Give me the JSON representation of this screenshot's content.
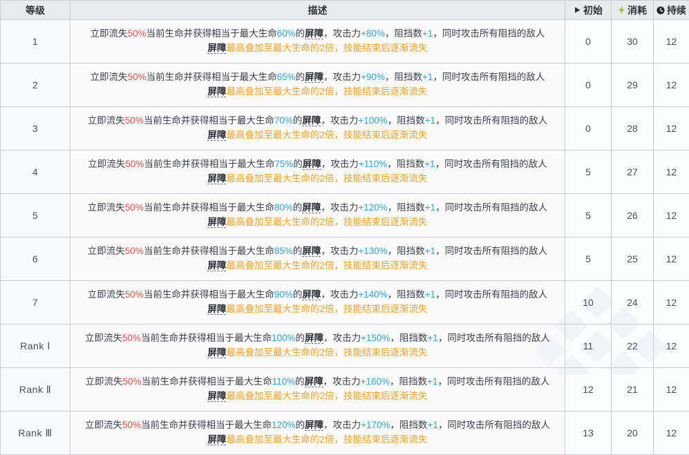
{
  "table": {
    "columns": [
      {
        "key": "level",
        "label": "等级",
        "icon": null
      },
      {
        "key": "desc",
        "label": "描述",
        "icon": null
      },
      {
        "key": "initial",
        "label": "初始",
        "icon": "play-triangle-icon"
      },
      {
        "key": "cost",
        "label": "消耗",
        "icon": "lightning-bolt-icon"
      },
      {
        "key": "duration",
        "label": "持续",
        "icon": "clock-icon"
      }
    ],
    "colors": {
      "hp_cost": "#ff4b3e",
      "buff_value": "#27a5e8",
      "note": "#f6a01a",
      "term": "#2b2f35",
      "header_bg": "#e9eaec",
      "row_bg": "#f8f9fa",
      "border": "#c9ced6"
    },
    "text_fragments": {
      "t1": "立即流失",
      "t2": "当前生命并获得相当于最大生命",
      "t3": "的",
      "t4": "，攻击力",
      "t5": "，阻挡数",
      "t6": "，同时攻击所有阻挡的敌人",
      "note_tail": "最高叠加至最大生命的2倍，技能结束后逐渐流失",
      "term_label": "屏障",
      "hp_loss": "50%",
      "block_bonus": "+1"
    },
    "rows": [
      {
        "level": "1",
        "shield": "60%",
        "atk": "+80%",
        "initial": "0",
        "cost": "30",
        "duration": "12"
      },
      {
        "level": "2",
        "shield": "65%",
        "atk": "+90%",
        "initial": "0",
        "cost": "29",
        "duration": "12"
      },
      {
        "level": "3",
        "shield": "70%",
        "atk": "+100%",
        "initial": "0",
        "cost": "28",
        "duration": "12"
      },
      {
        "level": "4",
        "shield": "75%",
        "atk": "+110%",
        "initial": "5",
        "cost": "27",
        "duration": "12"
      },
      {
        "level": "5",
        "shield": "80%",
        "atk": "+120%",
        "initial": "5",
        "cost": "26",
        "duration": "12"
      },
      {
        "level": "6",
        "shield": "85%",
        "atk": "+130%",
        "initial": "5",
        "cost": "25",
        "duration": "12"
      },
      {
        "level": "7",
        "shield": "90%",
        "atk": "+140%",
        "initial": "10",
        "cost": "24",
        "duration": "12"
      },
      {
        "level": "Rank Ⅰ",
        "shield": "100%",
        "atk": "+150%",
        "initial": "11",
        "cost": "22",
        "duration": "12"
      },
      {
        "level": "Rank Ⅱ",
        "shield": "110%",
        "atk": "+160%",
        "initial": "12",
        "cost": "21",
        "duration": "12"
      },
      {
        "level": "Rank Ⅲ",
        "shield": "120%",
        "atk": "+170%",
        "initial": "13",
        "cost": "20",
        "duration": "12"
      }
    ]
  }
}
